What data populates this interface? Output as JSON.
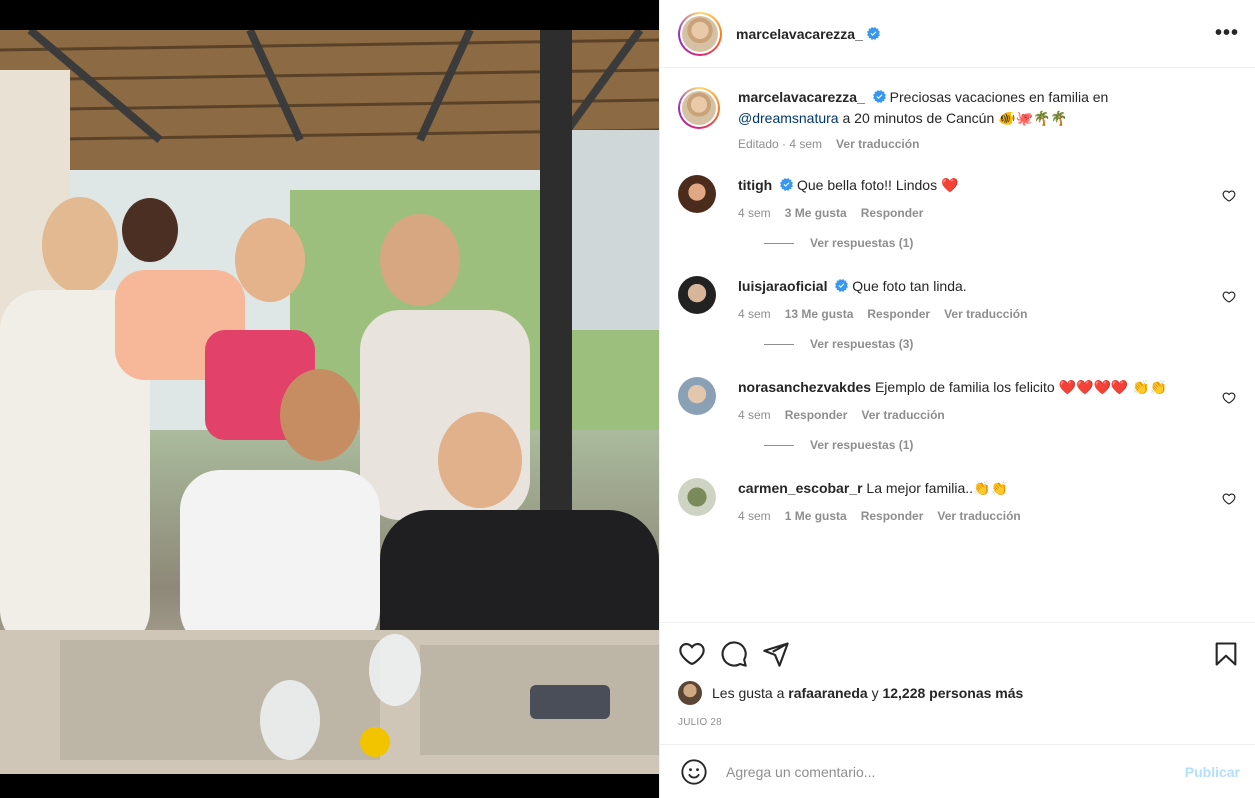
{
  "post": {
    "username": "marcelavacarezza_",
    "more_icon": "more-icon",
    "caption": {
      "text": "Preciosas vacaciones en familia en",
      "mention": "@dreamsnatura",
      "text2": "a 20 minutos de Cancún",
      "emojis": "🐠🐙🌴🌴",
      "meta_edited": "Editado · 4 sem",
      "meta_translate": "Ver traducción"
    }
  },
  "comments": [
    {
      "user": "titigh",
      "verified": true,
      "text": "Que bella foto!! Lindos",
      "emojis": "❤️",
      "time": "4 sem",
      "likes": "3 Me gusta",
      "reply": "Responder",
      "translate": "",
      "replies": "Ver respuestas (1)"
    },
    {
      "user": "luisjaraoficial",
      "verified": true,
      "text": "Que foto tan linda.",
      "emojis": "",
      "time": "4 sem",
      "likes": "13 Me gusta",
      "reply": "Responder",
      "translate": "Ver traducción",
      "replies": "Ver respuestas (3)"
    },
    {
      "user": "norasanchezvakdes",
      "verified": false,
      "text": "Ejemplo de familia los felicito",
      "emojis": "❤️❤️❤️❤️ 👏👏",
      "time": "4 sem",
      "likes": "",
      "reply": "Responder",
      "translate": "Ver traducción",
      "replies": "Ver respuestas (1)"
    },
    {
      "user": "carmen_escobar_r",
      "verified": false,
      "text": "La mejor familia..",
      "emojis": "👏👏",
      "time": "4 sem",
      "likes": "1 Me gusta",
      "reply": "Responder",
      "translate": "Ver traducción",
      "replies": ""
    }
  ],
  "actions": {
    "likes_prefix": "Les gusta a",
    "likes_user": "rafaaraneda",
    "likes_and": "y",
    "likes_count": "12,228 personas más",
    "date": "JULIO 28"
  },
  "composer": {
    "placeholder": "Agrega un comentario...",
    "publish": "Publicar"
  },
  "colors": {
    "verified": "#3897f0",
    "heart_red": "#ed4956",
    "link": "#00376b",
    "publish_disabled": "#b2dffc"
  }
}
